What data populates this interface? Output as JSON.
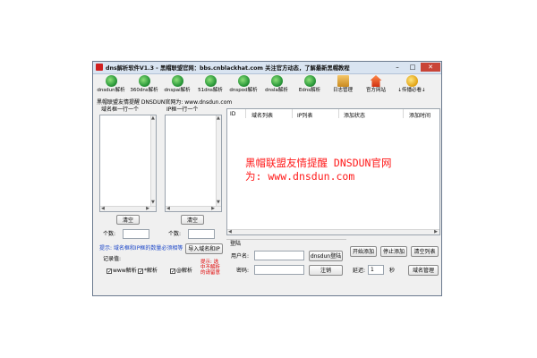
{
  "window": {
    "title": "dns解析软件V1.3 - 黑帽联盟官网：bbs.cnblackhat.com  关注官方动态，了解最新黑帽教程",
    "min": "–",
    "max": "□",
    "close": "✕"
  },
  "toolbar": {
    "items": [
      {
        "label": "dnsdun解析",
        "icon": "globe-icon"
      },
      {
        "label": "360dns解析",
        "icon": "globe-icon"
      },
      {
        "label": "dnspai解析",
        "icon": "globe-icon"
      },
      {
        "label": "51dns解析",
        "icon": "globe-icon"
      },
      {
        "label": "dnspod解析",
        "icon": "globe-icon"
      },
      {
        "label": "dnsla解析",
        "icon": "globe-icon"
      },
      {
        "label": "Edns解析",
        "icon": "globe-icon"
      },
      {
        "label": "日志管理",
        "icon": "log-icon"
      },
      {
        "label": "官方网站",
        "icon": "home-icon"
      },
      {
        "label": "↓传播必看↓",
        "icon": "search-icon"
      }
    ]
  },
  "notice": "黑帽联盟友情提醒 DNSDUN官网为: www.dnsdun.com",
  "left": {
    "domain_header": "域名框一行一个",
    "ip_header": "IP框一行一个",
    "clear1": "清空",
    "clear2": "清空",
    "count_label1": "个数:",
    "count_label2": "个数:",
    "hint": "提示: 域名框和IP框的数量必须相等",
    "import_button": "导入域名和IP",
    "record_label": "记录值:",
    "red_note": "提示: 选中不解析的请留意",
    "checks": [
      {
        "label": "www解析",
        "checked": true
      },
      {
        "label": "*解析",
        "checked": true
      },
      {
        "label": "@解析",
        "checked": true
      }
    ]
  },
  "table": {
    "columns": [
      "ID",
      "域名列表",
      "IP列表",
      "添加状态",
      "添加时间"
    ],
    "watermark_line1": "黑帽联盟友情提醒 DNSDUN官网",
    "watermark_line2": "为: www.dnsdun.com"
  },
  "login": {
    "group": "登陆",
    "user_label": "用户名:",
    "pass_label": "密码:",
    "login_button": "dnsdun登陆",
    "register_button": "注销"
  },
  "controls": {
    "start": "开始添加",
    "stop": "停止添加",
    "clear_list": "清空列表",
    "delay_label": "延迟:",
    "delay_value": "1",
    "delay_unit": "秒",
    "domain_manage": "域名管理"
  }
}
